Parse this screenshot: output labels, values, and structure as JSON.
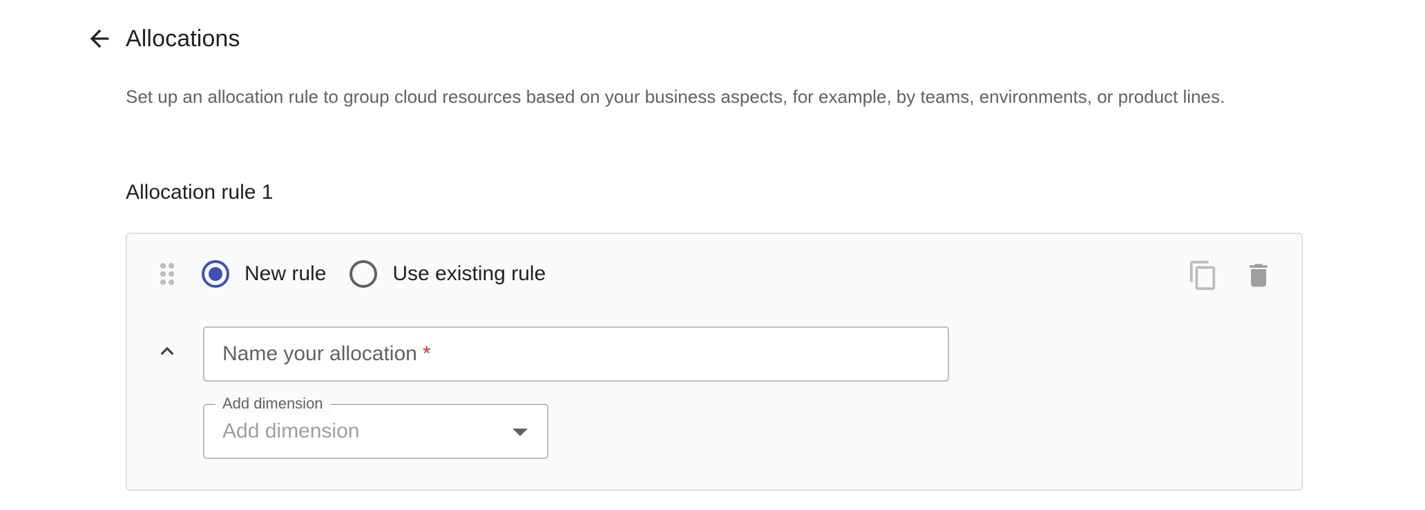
{
  "header": {
    "title": "Allocations",
    "back_icon": "arrow-back-icon"
  },
  "description": "Set up an allocation rule to group cloud resources based on your business aspects, for example, by teams, environments, or product lines.",
  "section_title": "Allocation rule 1",
  "rule_card": {
    "radio_options": [
      {
        "label": "New rule",
        "selected": true
      },
      {
        "label": "Use existing rule",
        "selected": false
      }
    ],
    "actions": {
      "copy_icon": "copy-icon",
      "delete_icon": "trash-icon"
    },
    "name_field": {
      "placeholder": "Name your allocation",
      "required_marker": "*",
      "value": ""
    },
    "dimension_select": {
      "label": "Add dimension",
      "placeholder": "Add dimension"
    }
  },
  "colors": {
    "accent": "#3f51b5",
    "required": "#d32f2f",
    "card_background": "#fafafa",
    "card_border": "#e0e0e0",
    "muted_text": "#616161"
  }
}
